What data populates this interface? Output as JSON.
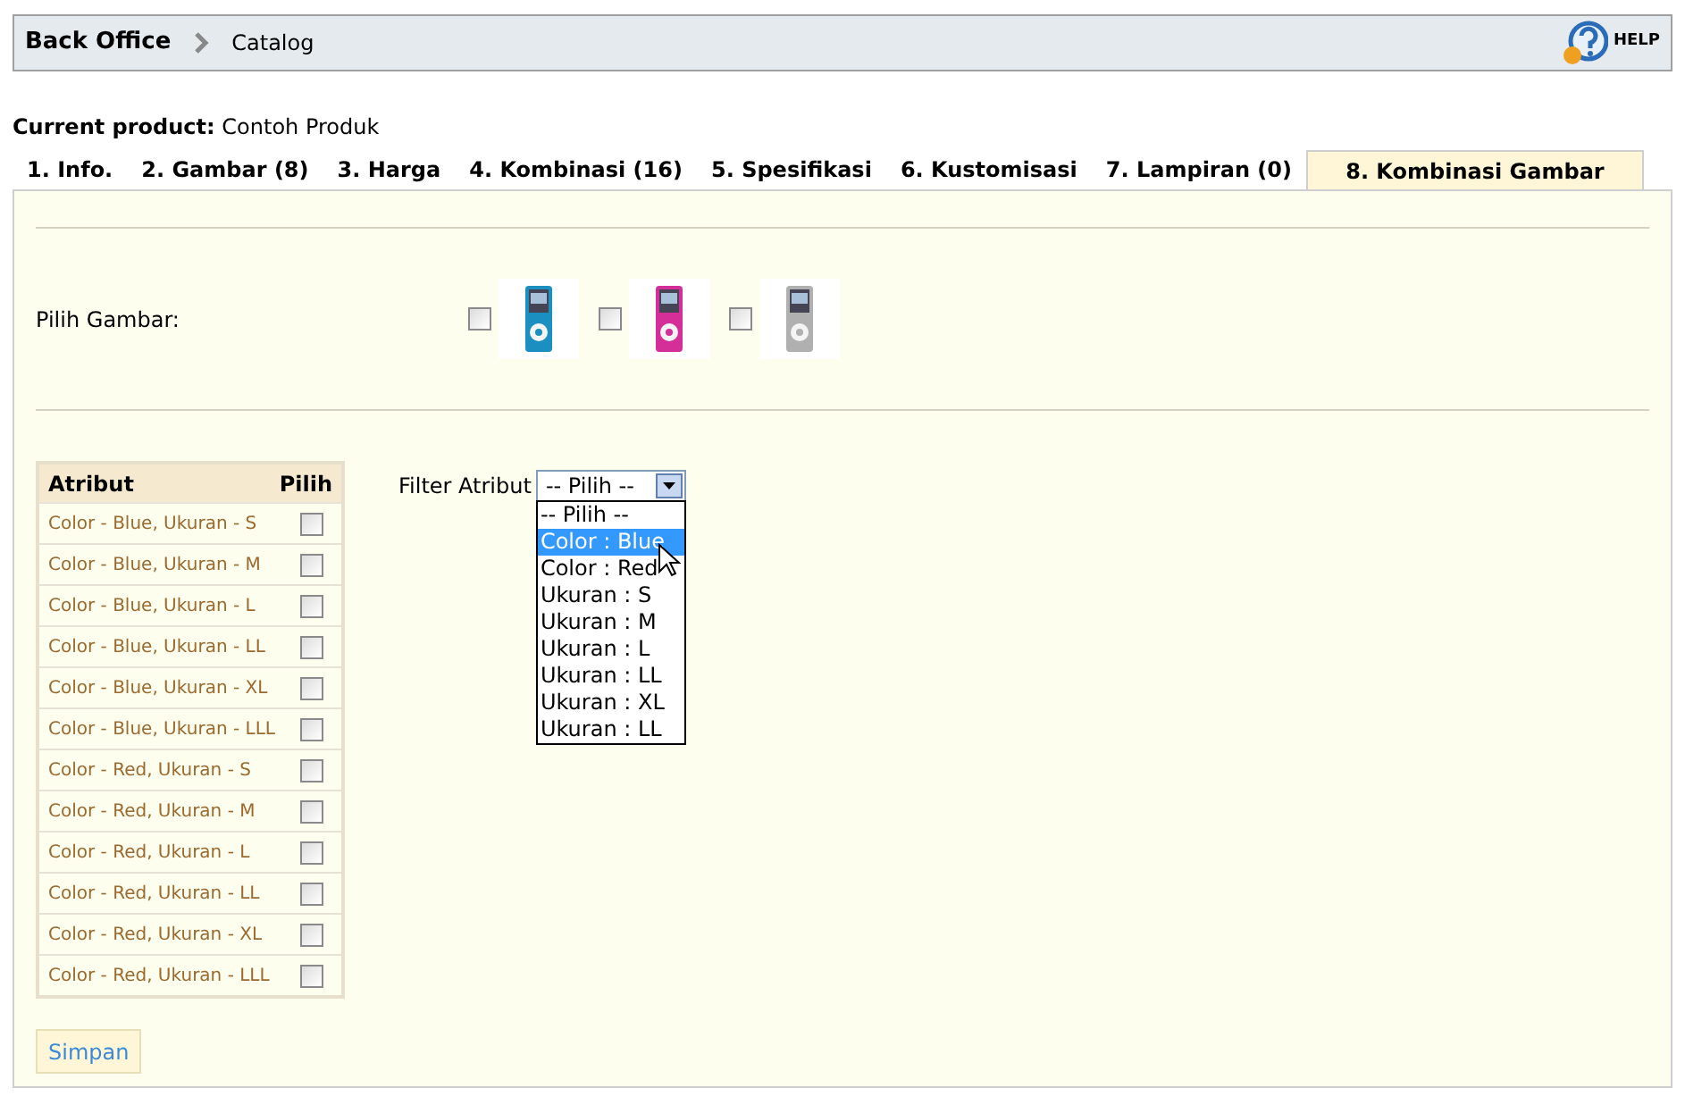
{
  "breadcrumb": {
    "items": [
      "Back Office",
      "Catalog"
    ],
    "help": "HELP"
  },
  "current_product": {
    "label": "Current product:",
    "value": "Contoh Produk"
  },
  "tabs": [
    {
      "label": "1. Info.",
      "selected": false
    },
    {
      "label": "2. Gambar (8)",
      "selected": false
    },
    {
      "label": "3. Harga",
      "selected": false
    },
    {
      "label": "4. Kombinasi (16)",
      "selected": false
    },
    {
      "label": "5. Spesifikasi",
      "selected": false
    },
    {
      "label": "6. Kustomisasi",
      "selected": false
    },
    {
      "label": "7. Lampiran (0)",
      "selected": false
    },
    {
      "label": "8. Kombinasi Gambar",
      "selected": true
    }
  ],
  "images": {
    "label": "Pilih Gambar:"
  },
  "table": {
    "columns": [
      "Atribut",
      "Pilih"
    ],
    "rows": [
      {
        "label": "Color - Blue, Ukuran - S",
        "checked": false
      },
      {
        "label": "Color - Blue, Ukuran - M",
        "checked": false
      },
      {
        "label": "Color - Blue, Ukuran - L",
        "checked": false
      },
      {
        "label": "Color - Blue, Ukuran - LL",
        "checked": false
      },
      {
        "label": "Color - Blue, Ukuran - XL",
        "checked": false
      },
      {
        "label": "Color - Blue, Ukuran - LLL",
        "checked": false
      },
      {
        "label": "Color - Red, Ukuran - S",
        "checked": false
      },
      {
        "label": "Color - Red, Ukuran - M",
        "checked": false
      },
      {
        "label": "Color - Red, Ukuran - L",
        "checked": false
      },
      {
        "label": "Color - Red, Ukuran - LL",
        "checked": false
      },
      {
        "label": "Color - Red, Ukuran - XL",
        "checked": false
      },
      {
        "label": "Color - Red, Ukuran - LLL",
        "checked": false
      }
    ]
  },
  "filter": {
    "label": "Filter Atribut",
    "value": "-- Pilih --",
    "expanded": true,
    "options": [
      {
        "label": "-- Pilih --",
        "highlighted": false
      },
      {
        "label": "Color : Blue",
        "highlighted": true
      },
      {
        "label": "Color : Red",
        "highlighted": false
      },
      {
        "label": "Ukuran : S",
        "highlighted": false
      },
      {
        "label": "Ukuran : M",
        "highlighted": false
      },
      {
        "label": "Ukuran : L",
        "highlighted": false
      },
      {
        "label": "Ukuran : LL",
        "highlighted": false
      },
      {
        "label": "Ukuran : XL",
        "highlighted": false
      },
      {
        "label": "Ukuran : LL",
        "highlighted": false
      }
    ]
  },
  "save_button": "Simpan"
}
